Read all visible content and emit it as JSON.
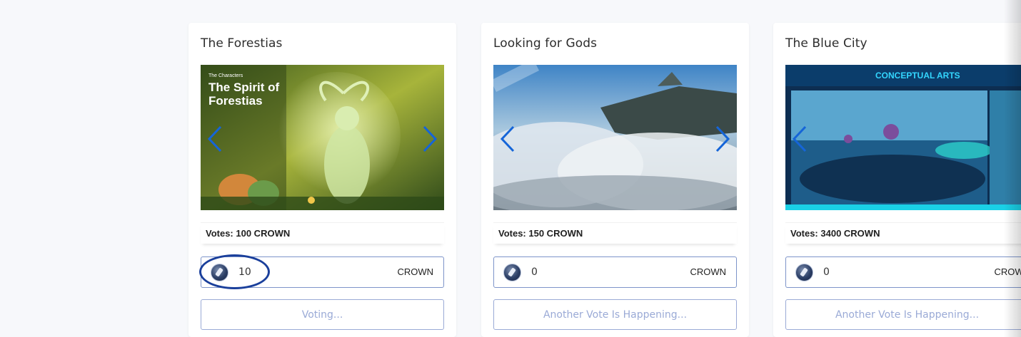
{
  "cards": [
    {
      "title": "The Forestias",
      "image": {
        "overlay_small": "The Characters",
        "overlay_title_1": "The Spirit of",
        "overlay_title_2": "Forestias"
      },
      "votes_label": "Votes: 100 CROWN",
      "amount_value": "10",
      "unit": "CROWN",
      "action_label": "Voting..."
    },
    {
      "title": "Looking for Gods",
      "votes_label": "Votes: 150 CROWN",
      "amount_value": "0",
      "unit": "CROWN",
      "action_label": "Another Vote Is Happening..."
    },
    {
      "title": "The Blue City",
      "image": {
        "banner_text": "CONCEPTUAL ARTS"
      },
      "votes_label": "Votes: 3400 CROWN",
      "amount_value": "0",
      "unit": "CROWN",
      "action_label": "Another Vote Is Happening..."
    }
  ],
  "icons": {
    "prev": "chevron-left-icon",
    "next": "chevron-right-icon",
    "token": "crown-token-icon"
  },
  "colors": {
    "arrow": "#1565d8",
    "input_border": "#7d94c9",
    "button_text": "#9aaad6",
    "highlight": "#1a3f9b"
  }
}
